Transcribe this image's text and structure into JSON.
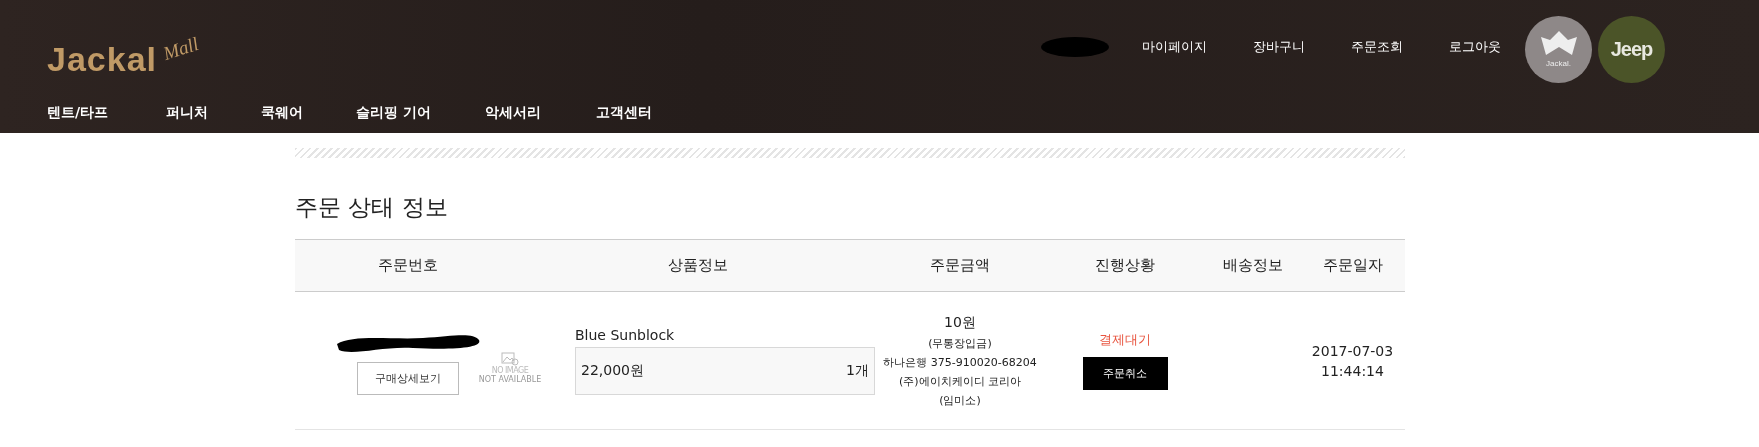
{
  "header": {
    "logo": {
      "name": "Jackal",
      "suffix": "Mall"
    },
    "nav": [
      "텐트/타프",
      "퍼니처",
      "쿡웨어",
      "슬리핑 기어",
      "악세서리",
      "고객센터"
    ],
    "user_links": [
      "마이페이지",
      "장바구니",
      "주문조회",
      "로그아웃"
    ],
    "brands": [
      {
        "label": "Jackal.",
        "color": "#8e8888"
      },
      {
        "label": "Jeep",
        "color": "#4b5428"
      }
    ]
  },
  "section_title": "주문 상태 정보",
  "table": {
    "columns": [
      "주문번호",
      "상품정보",
      "주문금액",
      "진행상황",
      "배송정보",
      "주문일자"
    ],
    "rows": [
      {
        "detail_button": "구매상세보기",
        "product": {
          "image": {
            "line_1": "NO IMAGE",
            "line_2": "NOT AVAILABLE"
          },
          "name": "Blue Sunblock",
          "price": "22,000원",
          "quantity": "1개"
        },
        "amount": {
          "total": "10원",
          "lines": [
            "(무통장입금)",
            "하나은행 375-910020-68204",
            "(주)에이치케이디 코리아",
            "(임미소)"
          ]
        },
        "status": {
          "label": "결제대기",
          "color": "#e8543f",
          "action": "주문취소"
        },
        "date": [
          "2017-07-03",
          "11:44:14"
        ]
      }
    ]
  }
}
